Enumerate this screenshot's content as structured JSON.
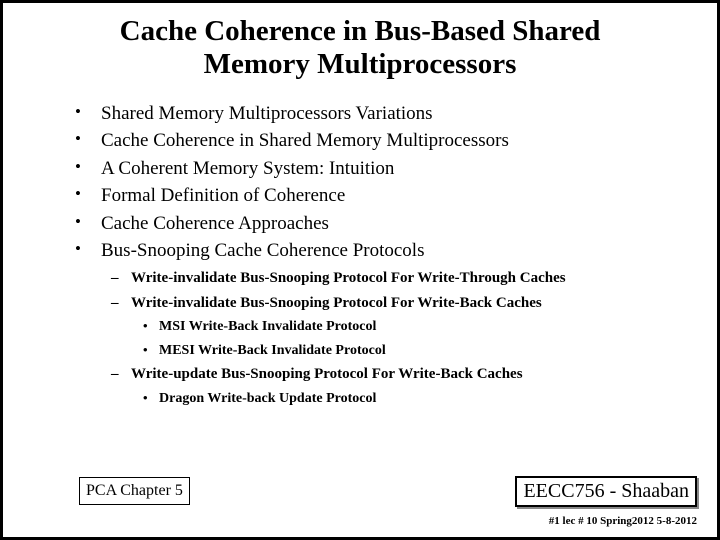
{
  "title": {
    "line1": "Cache Coherence in Bus-Based Shared",
    "line2": "Memory Multiprocessors"
  },
  "bullets": {
    "item1": "Shared Memory Multiprocessors Variations",
    "item2": "Cache Coherence in Shared Memory Multiprocessors",
    "item3": "A Coherent Memory System:  Intuition",
    "item4": "Formal Definition of Coherence",
    "item5": "Cache Coherence Approaches",
    "item6": "Bus-Snooping Cache Coherence Protocols",
    "dash1": "Write-invalidate Bus-Snooping Protocol  For Write-Through Caches",
    "dash2": "Write-invalidate Bus-Snooping Protocol For Write-Back Caches",
    "sub1": "MSI Write-Back Invalidate Protocol",
    "sub2": "MESI Write-Back Invalidate Protocol",
    "dash3": "Write-update Bus-Snooping Protocol For Write-Back Caches",
    "sub3": "Dragon Write-back Update Protocol"
  },
  "footer": {
    "left": "PCA Chapter 5",
    "course": "EECC756 - Shaaban",
    "pageinfo": "#1  lec # 10    Spring2012  5-8-2012"
  }
}
